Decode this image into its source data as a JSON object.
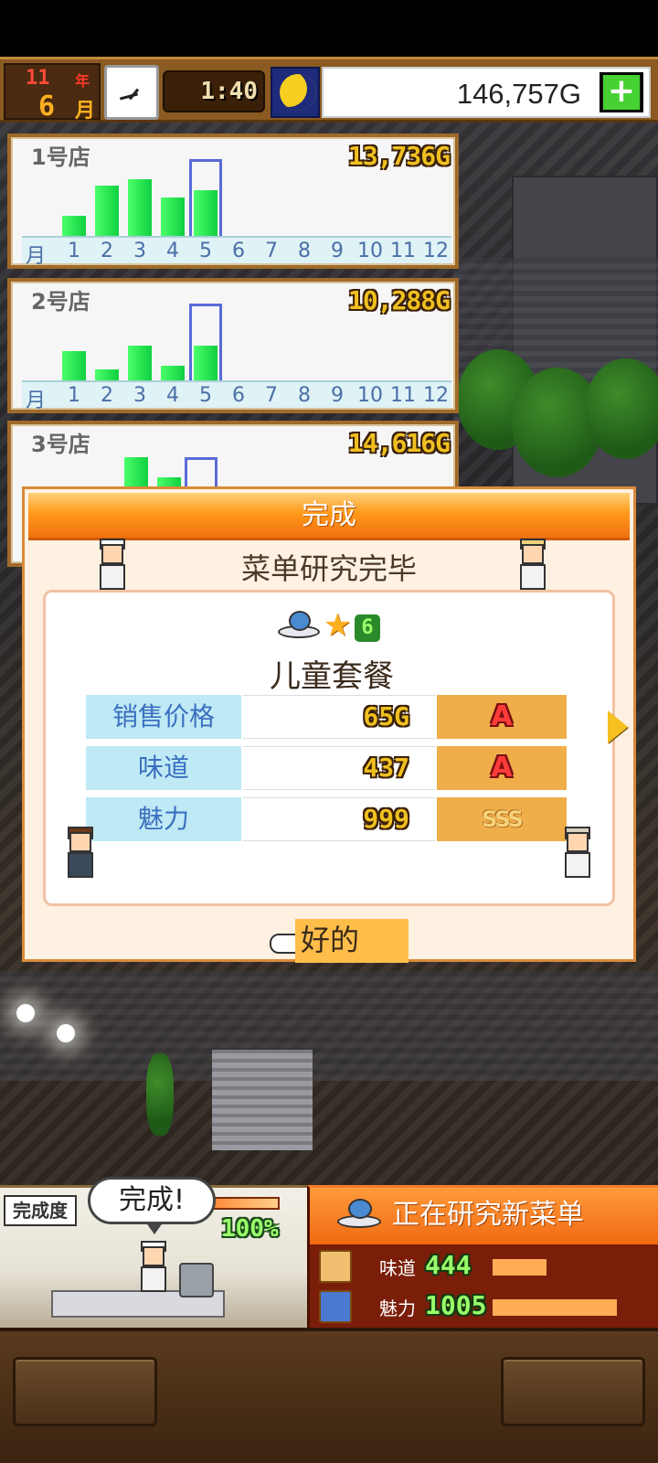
{
  "top_bar": {
    "year": "11",
    "year_unit": "年",
    "month": "6",
    "month_unit": "月",
    "time": "1:40",
    "money": "146,757G",
    "add_money_label": "+",
    "time_of_day_icon": "moon-icon"
  },
  "stores": [
    {
      "name": "1号店",
      "sales": "13,736G",
      "months_label": "月",
      "months": [
        "1",
        "2",
        "3",
        "4",
        "5",
        "6",
        "7",
        "8",
        "9",
        "10",
        "11",
        "12"
      ],
      "bar_values": [
        0.22,
        0.55,
        0.62,
        0.42,
        0.5,
        0,
        0,
        0,
        0,
        0,
        0,
        0
      ],
      "selected_month": 5
    },
    {
      "name": "2号店",
      "sales": "10,288G",
      "months_label": "月",
      "months": [
        "1",
        "2",
        "3",
        "4",
        "5",
        "6",
        "7",
        "8",
        "9",
        "10",
        "11",
        "12"
      ],
      "bar_values": [
        0.32,
        0.12,
        0.38,
        0.16,
        0.38,
        0,
        0,
        0,
        0,
        0,
        0,
        0
      ],
      "selected_month": 5
    },
    {
      "name": "3号店",
      "sales": "14,616G",
      "selected_month": 5
    }
  ],
  "dialog": {
    "title": "完成",
    "subtitle": "菜单研究完毕",
    "star_level": "6",
    "dish_name": "儿童套餐",
    "stats": [
      {
        "label": "销售价格",
        "value": "65G",
        "grade": "A"
      },
      {
        "label": "味道",
        "value": "437",
        "grade": "A"
      },
      {
        "label": "魅力",
        "value": "999",
        "grade": "SSS"
      }
    ],
    "ok_label": "好的"
  },
  "research": {
    "progress_label": "完成度",
    "speech": "完成!",
    "progress_pct": "100%",
    "progress_fraction": 1.0,
    "title": "正在研究新菜单",
    "stats": [
      {
        "label": "味道",
        "value": "444",
        "bar_fraction": 0.35,
        "icon": "taste-icon"
      },
      {
        "label": "魅力",
        "value": "1005",
        "bar_fraction": 0.8,
        "icon": "charm-icon"
      }
    ]
  },
  "colors": {
    "accent_orange": "#ff9a1a",
    "bar_green": "#10d040",
    "gold_text": "#f0c020",
    "wood_brown": "#8a5a22"
  }
}
